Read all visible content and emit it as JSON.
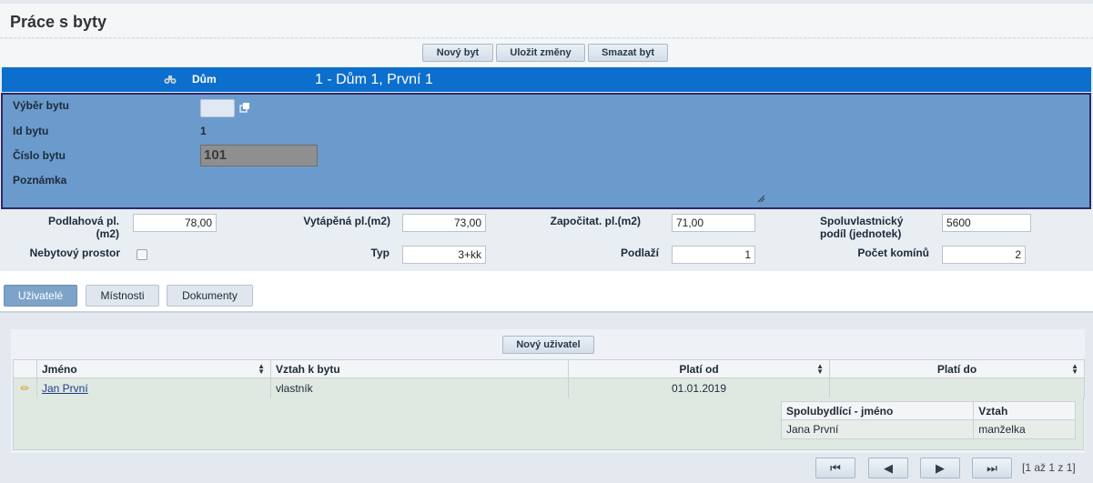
{
  "page": {
    "title": "Práce s byty"
  },
  "toolbar": {
    "new_flat": "Nový byt",
    "save_changes": "Uložit změny",
    "delete_flat": "Smazat byt"
  },
  "house": {
    "label": "Dům",
    "value": "1 - Dům 1, První 1",
    "icon": "binoculars-icon"
  },
  "flat": {
    "select_label": "Výběr bytu",
    "id_label": "Id bytu",
    "id_value": "1",
    "number_label": "Číslo bytu",
    "number_value": "101",
    "note_label": "Poznámka"
  },
  "props": {
    "floor_area_label": "Podlahová pl.(m2)",
    "floor_area_value": "78,00",
    "heated_area_label": "Vytápěná pl.(m2)",
    "heated_area_value": "73,00",
    "counted_area_label": "Započitat. pl.(m2)",
    "counted_area_value": "71,00",
    "coownership_label_1": "Spoluvlastnický",
    "coownership_label_2": "podíl (jednotek)",
    "coownership_value": "5600",
    "nonresidential_label": "Nebytový prostor",
    "type_label": "Typ",
    "type_value": "3+kk",
    "floor_label": "Podlaží",
    "floor_value": "1",
    "chimneys_label": "Počet komínů",
    "chimneys_value": "2"
  },
  "tabs": [
    {
      "label": "Uživatelé",
      "active": true
    },
    {
      "label": "Místnosti",
      "active": false
    },
    {
      "label": "Dokumenty",
      "active": false
    }
  ],
  "users": {
    "new_user": "Nový uživatel",
    "columns": [
      "Jméno",
      "Vztah k bytu",
      "Platí od",
      "Platí do"
    ],
    "rows": [
      {
        "name": "Jan První",
        "relation": "vlastník",
        "valid_from": "01.01.2019",
        "valid_to": ""
      }
    ],
    "cotenants": {
      "columns": [
        "Spolubydlící - jméno",
        "Vztah"
      ],
      "rows": [
        {
          "name": "Jana První",
          "relation": "manželka"
        }
      ]
    }
  },
  "pager": {
    "first": "⏮",
    "prev": "◀",
    "next": "▶",
    "last": "⏭",
    "info": "[1 až 1 z 1]"
  },
  "colors": {
    "house_bar": "#0c6fcd",
    "flat_panel": "#6b9bcd",
    "active_tab": "#7ea3c9",
    "row_bg": "#dfe9e1"
  }
}
